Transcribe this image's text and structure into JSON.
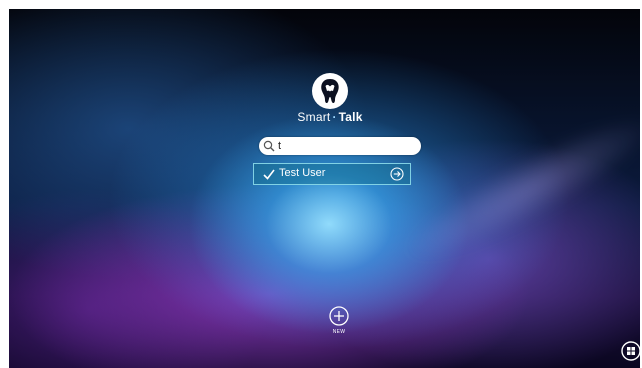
{
  "app": {
    "brand_part1": "Smart",
    "brand_separator": "·",
    "brand_part2": "Talk"
  },
  "search": {
    "value": "t",
    "placeholder": "",
    "icon": "search-icon"
  },
  "users": [
    {
      "name": "Test User",
      "selected": true,
      "icon_left": "check-icon",
      "icon_right": "arrow-right-circle-icon"
    }
  ],
  "new_user": {
    "label": "NEW",
    "icon": "plus-circle-icon"
  },
  "corner": {
    "icon": "windows-logo-icon"
  },
  "colors": {
    "accent": "#8cdcEB",
    "row_fill": "#146e8c",
    "text": "#ffffff"
  }
}
